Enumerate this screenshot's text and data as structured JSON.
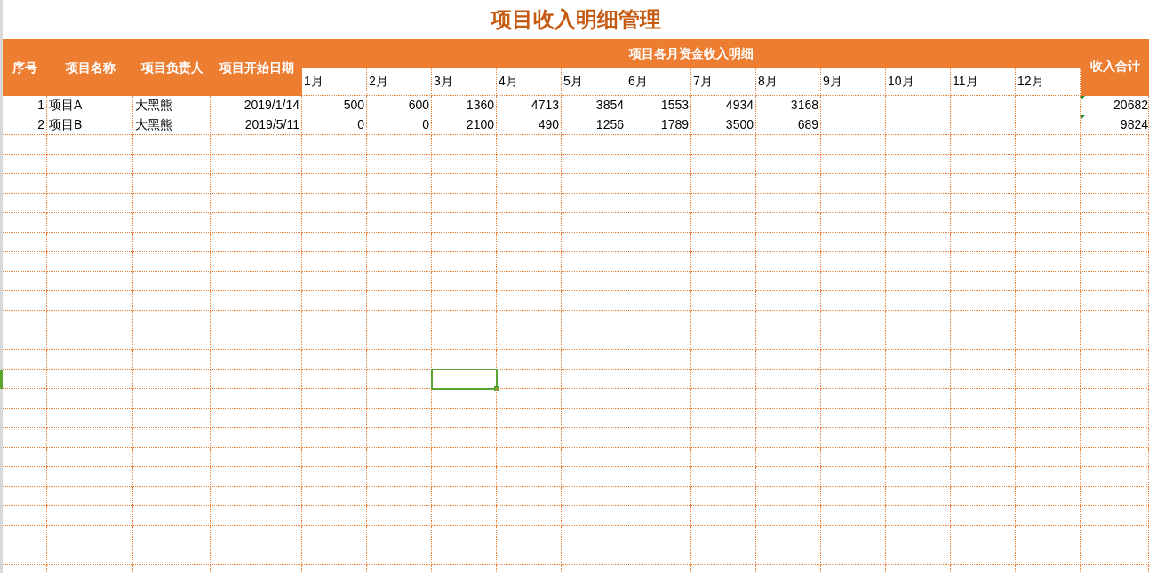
{
  "title": "项目收入明细管理",
  "columns": {
    "index": "序号",
    "name": "项目名称",
    "owner": "项目负责人",
    "start_date": "项目开始日期",
    "months_group": "项目各月资金收入明细",
    "total": "收入合计"
  },
  "months": [
    {
      "label": "1月",
      "selected": false
    },
    {
      "label": "2月",
      "selected": false
    },
    {
      "label": "3月",
      "selected": true
    },
    {
      "label": "4月",
      "selected": false
    },
    {
      "label": "5月",
      "selected": false
    },
    {
      "label": "6月",
      "selected": false
    },
    {
      "label": "7月",
      "selected": false
    },
    {
      "label": "8月",
      "selected": false
    },
    {
      "label": "9月",
      "selected": false
    },
    {
      "label": "10月",
      "selected": false
    },
    {
      "label": "11月",
      "selected": false
    },
    {
      "label": "12月",
      "selected": false
    }
  ],
  "rows": [
    {
      "index": "1",
      "name": "项目A",
      "owner": "大黑熊",
      "start_date": "2019/1/14",
      "months": [
        "500",
        "600",
        "1360",
        "4713",
        "3854",
        "1553",
        "4934",
        "3168"
      ],
      "total": "20682",
      "warning": true
    },
    {
      "index": "2",
      "name": "项目B",
      "owner": "大黑熊",
      "start_date": "2019/5/11",
      "months": [
        "0",
        "0",
        "2100",
        "490",
        "1256",
        "1789",
        "3500",
        "689"
      ],
      "total": "9824",
      "warning": true
    }
  ],
  "blank_rows": [
    {
      "selected": false
    },
    {
      "selected": false
    },
    {
      "selected": false
    },
    {
      "selected": false
    },
    {
      "selected": false
    },
    {
      "selected": false
    },
    {
      "selected": false
    },
    {
      "selected": false
    },
    {
      "selected": false
    },
    {
      "selected": false
    },
    {
      "selected": false
    },
    {
      "selected": false
    },
    {
      "selected": true
    },
    {
      "selected": false
    },
    {
      "selected": false
    },
    {
      "selected": false
    },
    {
      "selected": false
    },
    {
      "selected": false
    },
    {
      "selected": false
    },
    {
      "selected": false
    },
    {
      "selected": false
    },
    {
      "selected": false
    },
    {
      "selected": false
    }
  ]
}
